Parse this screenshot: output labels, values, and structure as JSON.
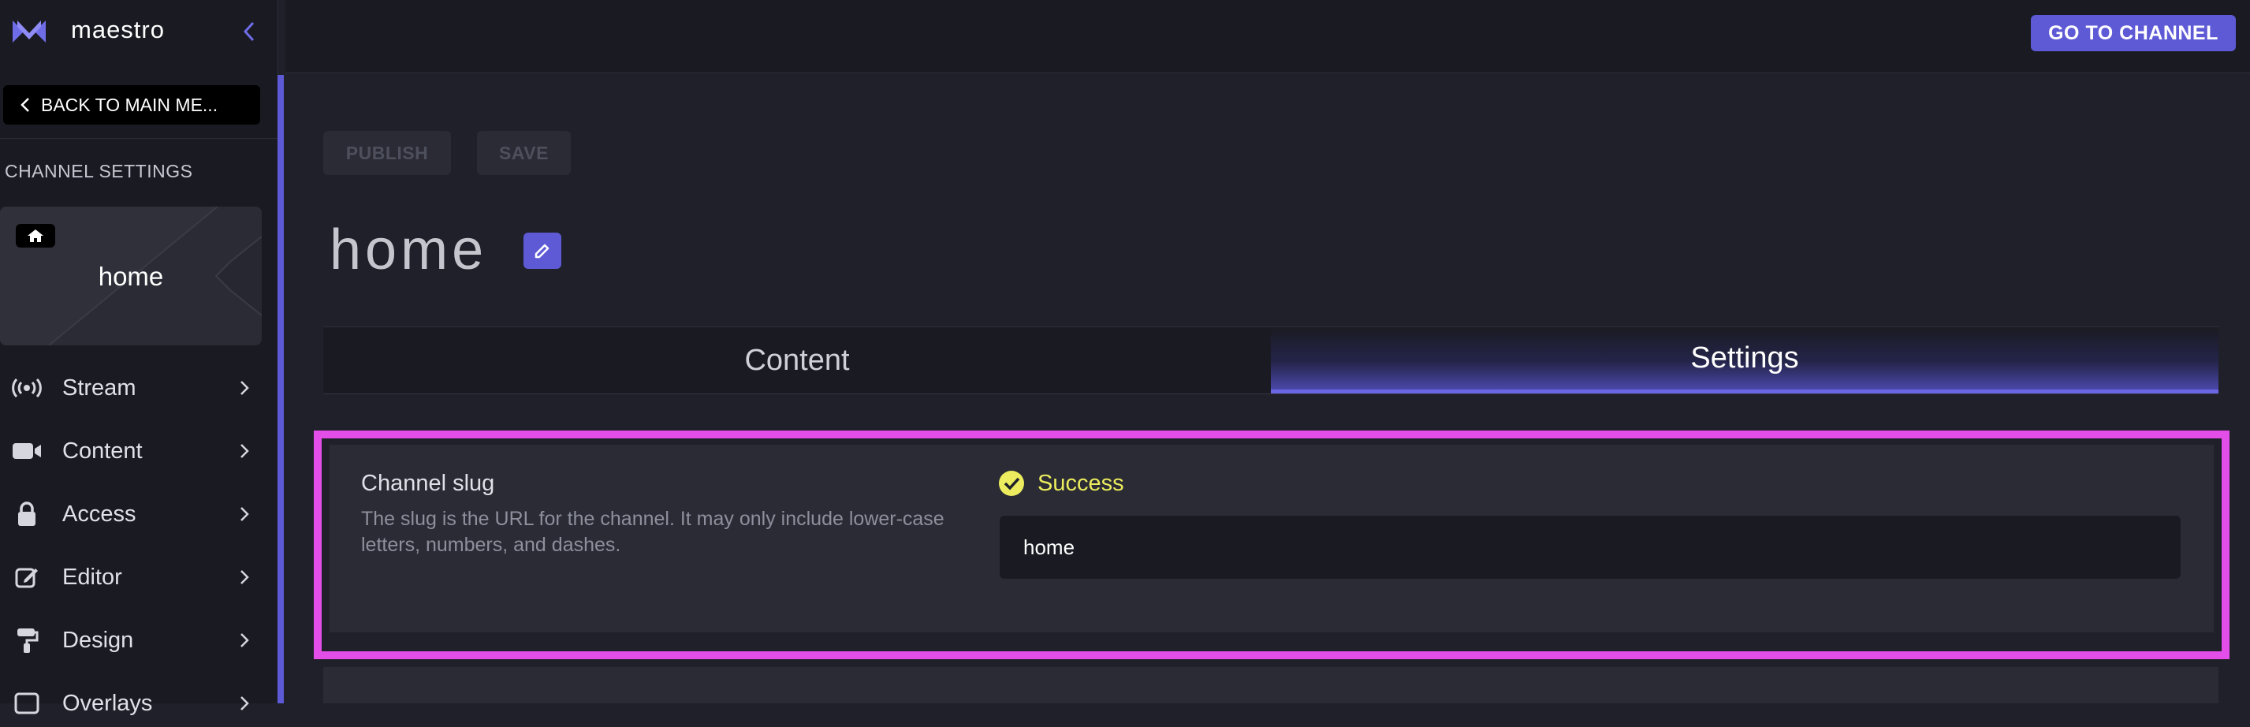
{
  "brand": {
    "name": "maestro"
  },
  "topbar": {
    "go_to_channel": "GO TO CHANNEL"
  },
  "sidebar": {
    "back_label": "BACK TO MAIN ME...",
    "section_title": "CHANNEL SETTINGS",
    "page_card_label": "home",
    "items": [
      {
        "label": "Stream",
        "icon": "broadcast-icon"
      },
      {
        "label": "Content",
        "icon": "video-camera-icon"
      },
      {
        "label": "Access",
        "icon": "lock-icon"
      },
      {
        "label": "Editor",
        "icon": "edit-icon"
      },
      {
        "label": "Design",
        "icon": "paint-roller-icon"
      },
      {
        "label": "Overlays",
        "icon": "overlay-icon"
      }
    ]
  },
  "toolbar": {
    "publish_label": "PUBLISH",
    "save_label": "SAVE"
  },
  "page": {
    "title": "home"
  },
  "tabs": [
    {
      "label": "Content",
      "active": false
    },
    {
      "label": "Settings",
      "active": true
    }
  ],
  "slug": {
    "title": "Channel slug",
    "description": "The slug is the URL for the channel. It may only include lower-case letters, numbers, and dashes.",
    "status": "Success",
    "value": "home"
  },
  "colors": {
    "accent": "#5e5ad6",
    "success": "#ecec5e",
    "highlight": "#e34de8",
    "background": "#1f2029"
  }
}
